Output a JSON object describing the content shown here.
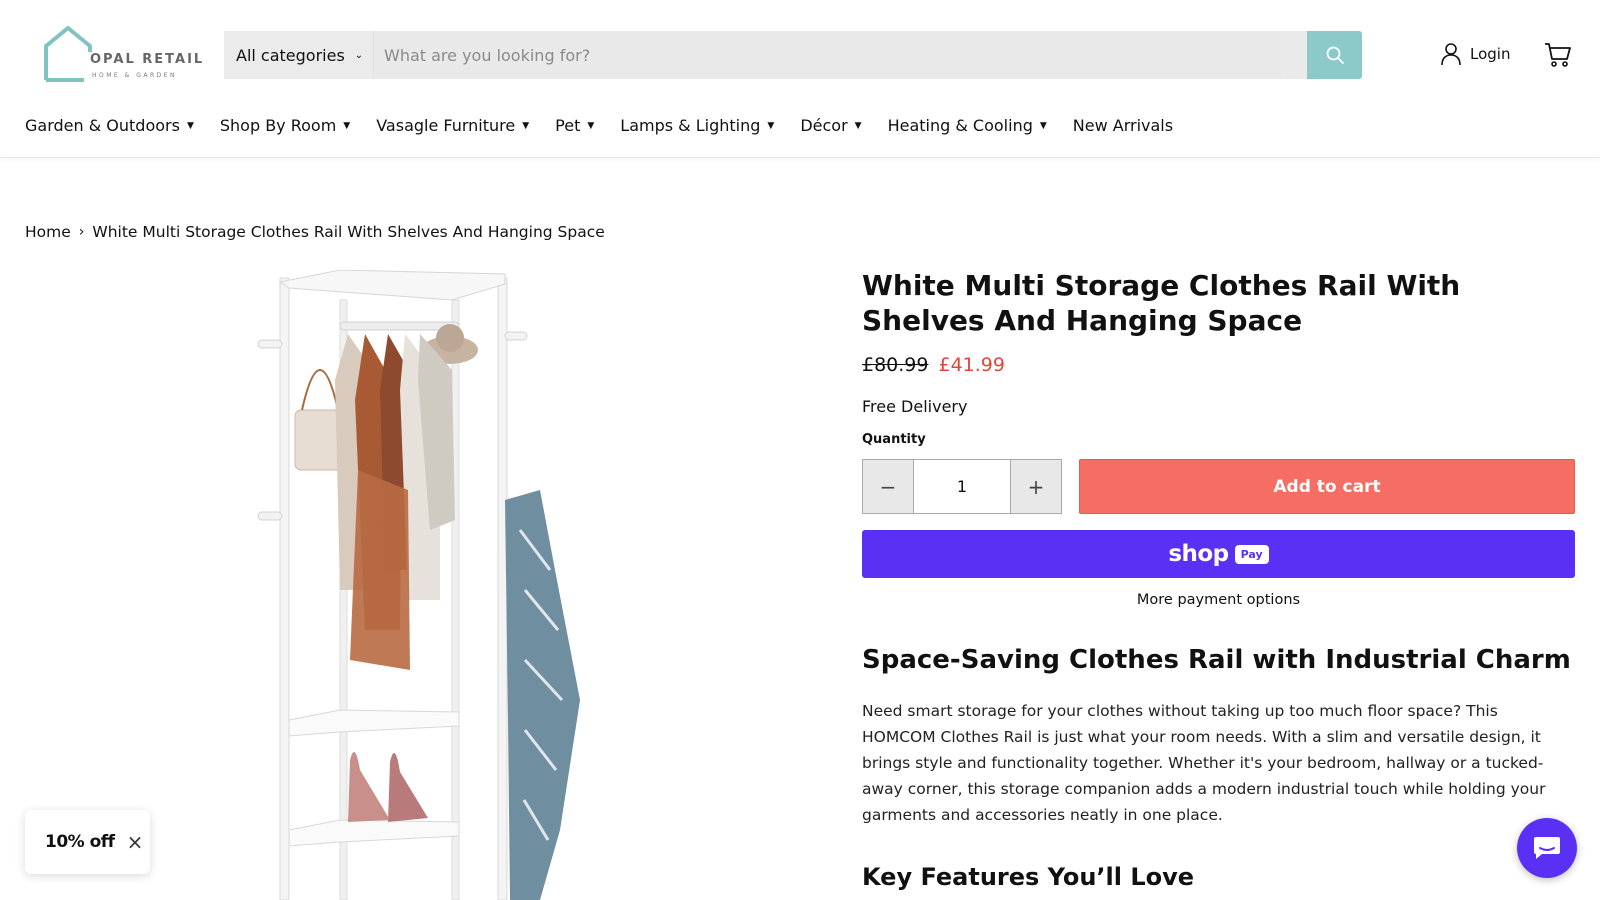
{
  "header": {
    "logo": {
      "name": "OPAL RETAIL",
      "tagline": "HOME & GARDEN",
      "icon": "house-logo-icon"
    },
    "search": {
      "category": "All categories",
      "placeholder": "What are you looking for?",
      "value": "",
      "button_icon": "search-icon"
    },
    "login_label": "Login",
    "cart_icon": "cart-icon"
  },
  "nav": {
    "items": [
      {
        "label": "Garden & Outdoors",
        "has_dropdown": true
      },
      {
        "label": "Shop By Room",
        "has_dropdown": true
      },
      {
        "label": "Vasagle Furniture",
        "has_dropdown": true
      },
      {
        "label": "Pet",
        "has_dropdown": true
      },
      {
        "label": "Lamps & Lighting",
        "has_dropdown": true
      },
      {
        "label": "Décor",
        "has_dropdown": true
      },
      {
        "label": "Heating & Cooling",
        "has_dropdown": true
      },
      {
        "label": "New Arrivals",
        "has_dropdown": false
      }
    ]
  },
  "breadcrumb": {
    "home": "Home",
    "separator": "›",
    "current": "White Multi Storage Clothes Rail With Shelves And Hanging Space"
  },
  "product": {
    "title": "White Multi Storage Clothes Rail With Shelves And Hanging Space",
    "old_price": "£80.99",
    "new_price": "£41.99",
    "delivery": "Free Delivery",
    "quantity_label": "Quantity",
    "quantity": "1",
    "minus_label": "−",
    "plus_label": "+",
    "add_to_cart": "Add to cart",
    "shoppay_text": "shop",
    "shoppay_badge": "Pay",
    "more_payment": "More payment options"
  },
  "description": {
    "heading": "Space-Saving Clothes Rail with Industrial Charm",
    "body": "Need smart storage for your clothes without taking up too much floor space? This HOMCOM Clothes Rail is just what your room needs. With a slim and versatile design, it brings style and functionality together. Whether it's your bedroom, hallway or a tucked-away corner, this storage companion adds a modern industrial touch while holding your garments and accessories neatly in one place.",
    "features_heading": "Key Features You’ll Love"
  },
  "popup": {
    "text": "10% off",
    "close": "×"
  },
  "colors": {
    "accent": "#8bcac8",
    "add_to_cart": "#f66d63",
    "shoppay": "#5a31f4",
    "sale_price": "#e0463a"
  }
}
